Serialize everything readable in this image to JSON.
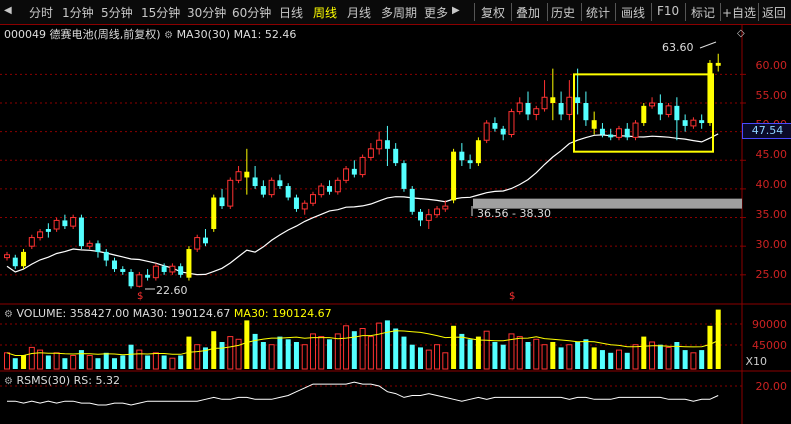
{
  "toolbar": {
    "left_arrow": "◀",
    "periods": [
      "分时",
      "1分钟",
      "5分钟",
      "15分钟",
      "30分钟",
      "60分钟",
      "日线",
      "周线",
      "月线",
      "多周期",
      "更多"
    ],
    "active_period": "周线",
    "right_arrow": "▶",
    "actions": [
      "复权",
      "叠加",
      "历史",
      "统计",
      "画线",
      "F10",
      "标记",
      "+自选",
      "返回"
    ]
  },
  "header": {
    "code": "000049",
    "name_info": "德赛电池(周线,前复权)",
    "ma30_label": "MA30(30)",
    "ma1_label": "MA1: 52.46"
  },
  "price_axis": {
    "ticks": [
      "60.00",
      "55.00",
      "50.00",
      "45.00",
      "40.00",
      "35.00",
      "30.00",
      "25.00"
    ],
    "current": "47.54"
  },
  "annotations": {
    "high": "63.60",
    "low": "22.60",
    "gap": "36.56 - 38.30",
    "marker": "$"
  },
  "volume": {
    "title": "VOLUME: 358427.00",
    "ma30_a": "MA30: 190124.67",
    "ma30_b": "MA30: 190124.67",
    "ticks": [
      "90000",
      "45000"
    ],
    "unit": "X10"
  },
  "rsms": {
    "title": "RSMS(30)",
    "rs": "RS: 5.32",
    "tick": "20.00"
  },
  "colors": {
    "up": "#ff3232",
    "down": "#54ffff",
    "highlight": "#ffff00",
    "ma": "#ffffff",
    "grid": "#8b0000"
  },
  "chart_data": {
    "type": "candlestick",
    "ylim": [
      22,
      66
    ],
    "candles": [
      [
        28,
        29,
        28.5,
        27.5
      ],
      [
        28,
        28.5,
        26.5,
        26
      ],
      [
        26.5,
        29.5,
        29,
        26
      ],
      [
        30,
        32,
        31.5,
        29.5
      ],
      [
        31.5,
        33,
        32.5,
        31
      ],
      [
        33,
        34,
        32.5,
        31.5
      ],
      [
        33,
        35,
        34.5,
        32.5
      ],
      [
        34.5,
        35.5,
        33.5,
        33
      ],
      [
        33.5,
        35.5,
        35,
        33
      ],
      [
        35,
        35.5,
        30,
        29.5
      ],
      [
        30,
        31,
        30.5,
        29.5
      ],
      [
        30.5,
        31,
        29,
        28
      ],
      [
        29,
        29.5,
        27.5,
        26.5
      ],
      [
        27.5,
        28,
        26,
        25.5
      ],
      [
        26,
        26.5,
        25.5,
        25
      ],
      [
        25.5,
        26,
        23,
        22.6
      ],
      [
        23,
        25.5,
        25,
        22.8
      ],
      [
        25,
        26,
        24.5,
        24
      ],
      [
        24.5,
        27,
        26.5,
        24
      ],
      [
        26.5,
        27,
        25.5,
        25
      ],
      [
        25.5,
        27,
        26.5,
        25
      ],
      [
        26.5,
        27,
        25,
        24.5
      ],
      [
        24.5,
        30,
        29.5,
        24
      ],
      [
        29.5,
        32,
        31.5,
        29
      ],
      [
        31.5,
        33,
        30.5,
        30
      ],
      [
        33,
        39,
        38.5,
        32.5
      ],
      [
        38.5,
        40,
        37,
        36.5
      ],
      [
        37,
        42,
        41.5,
        36.5
      ],
      [
        41.5,
        44,
        43,
        41
      ],
      [
        43,
        47,
        42,
        39
      ],
      [
        42,
        44,
        40.5,
        40
      ],
      [
        40.5,
        41.5,
        39,
        38.5
      ],
      [
        39,
        42,
        41.5,
        38.5
      ],
      [
        41.5,
        42.5,
        40.5,
        40
      ],
      [
        40.5,
        41,
        38.5,
        38
      ],
      [
        38.5,
        39,
        36.5,
        36
      ],
      [
        36.5,
        38,
        37.5,
        35.5
      ],
      [
        37.5,
        39.5,
        39,
        37
      ],
      [
        39,
        41,
        40.5,
        38.5
      ],
      [
        40.5,
        41.5,
        39.5,
        39
      ],
      [
        39.5,
        42,
        41.5,
        39
      ],
      [
        41.5,
        44,
        43.5,
        41
      ],
      [
        43.5,
        45,
        42.5,
        42
      ],
      [
        42.5,
        46,
        45.5,
        42
      ],
      [
        45.5,
        48,
        47,
        45
      ],
      [
        47,
        50,
        48.5,
        46
      ],
      [
        48.5,
        51,
        47,
        44
      ],
      [
        47,
        48,
        44.5,
        44
      ],
      [
        44.5,
        45,
        40,
        39.5
      ],
      [
        40,
        40.5,
        36,
        35.5
      ],
      [
        36,
        36.5,
        34.5,
        33.5
      ],
      [
        34.5,
        36.5,
        35.5,
        33
      ],
      [
        35.5,
        37,
        36.5,
        35
      ],
      [
        36.5,
        38,
        37,
        36
      ],
      [
        38,
        47,
        46.5,
        37.5
      ],
      [
        46.5,
        48,
        45,
        44
      ],
      [
        45,
        46,
        44.5,
        43.5
      ],
      [
        44.5,
        49,
        48.5,
        44
      ],
      [
        48.5,
        52,
        51.5,
        48
      ],
      [
        51.5,
        52.5,
        50.5,
        50
      ],
      [
        50.5,
        51,
        49.5,
        48.5
      ],
      [
        49.5,
        54,
        53.5,
        49
      ],
      [
        53.5,
        56,
        55,
        53
      ],
      [
        55,
        57,
        53,
        52
      ],
      [
        53,
        54.5,
        54,
        52
      ],
      [
        54,
        59,
        56,
        53.5
      ],
      [
        56,
        61,
        55,
        52
      ],
      [
        55,
        57,
        53,
        52
      ],
      [
        53,
        59,
        56,
        52
      ],
      [
        56,
        61,
        55,
        53
      ],
      [
        55,
        57,
        52,
        51
      ],
      [
        52,
        53.5,
        50.5,
        49.5
      ],
      [
        50.5,
        51.5,
        49.5,
        49
      ],
      [
        49.5,
        50.5,
        49,
        48.5
      ],
      [
        49,
        51,
        50.5,
        48.5
      ],
      [
        50.5,
        51.5,
        49,
        48.5
      ],
      [
        49,
        52,
        51.5,
        48.5
      ],
      [
        51.5,
        55,
        54.5,
        51
      ],
      [
        54.5,
        56,
        55,
        54
      ],
      [
        55,
        56.5,
        53,
        52
      ],
      [
        53,
        55,
        54.5,
        52.5
      ],
      [
        54.5,
        56,
        52,
        48.5
      ],
      [
        52,
        53,
        51,
        50
      ],
      [
        51,
        52.5,
        52,
        50.5
      ],
      [
        52,
        53,
        51.5,
        50.5
      ],
      [
        51.5,
        62.5,
        62,
        51
      ],
      [
        62,
        63.6,
        61.5,
        60.5
      ]
    ],
    "highlight_indices": [
      2,
      22,
      25,
      29,
      54,
      57,
      66,
      71,
      77,
      85,
      86
    ],
    "volume": [
      6,
      4,
      5,
      8,
      7,
      5,
      6,
      4,
      5,
      7,
      5,
      4,
      6,
      4,
      5,
      9,
      7,
      5,
      6,
      5,
      4,
      5,
      12,
      9,
      8,
      14,
      10,
      12,
      11,
      18,
      13,
      10,
      9,
      12,
      11,
      10,
      9,
      13,
      12,
      11,
      13,
      16,
      14,
      15,
      12,
      17,
      18,
      15,
      12,
      9,
      8,
      7,
      9,
      6,
      16,
      13,
      11,
      12,
      14,
      10,
      9,
      13,
      12,
      10,
      11,
      9,
      10,
      8,
      9,
      10,
      11,
      8,
      7,
      6,
      7,
      6,
      9,
      12,
      10,
      9,
      8,
      10,
      7,
      6,
      7,
      16,
      22
    ],
    "rsms": [
      12,
      12,
      11,
      12,
      11,
      12,
      11,
      12,
      12,
      11,
      11,
      10,
      10,
      11,
      11,
      10,
      11,
      12,
      12,
      12,
      12,
      12,
      12,
      12,
      13,
      14,
      13,
      13,
      14,
      14,
      13,
      13,
      13,
      14,
      15,
      17,
      19,
      21,
      21,
      21,
      21,
      21,
      22,
      21,
      21,
      20,
      17,
      16,
      14,
      15,
      15,
      16,
      15,
      14,
      13,
      12,
      13,
      14,
      13,
      14,
      14,
      14,
      14,
      14,
      14,
      14,
      14,
      14,
      13,
      14,
      14,
      13,
      13,
      13,
      14,
      14,
      14,
      14,
      14,
      14,
      13,
      13,
      13,
      12,
      13,
      13,
      15
    ]
  }
}
